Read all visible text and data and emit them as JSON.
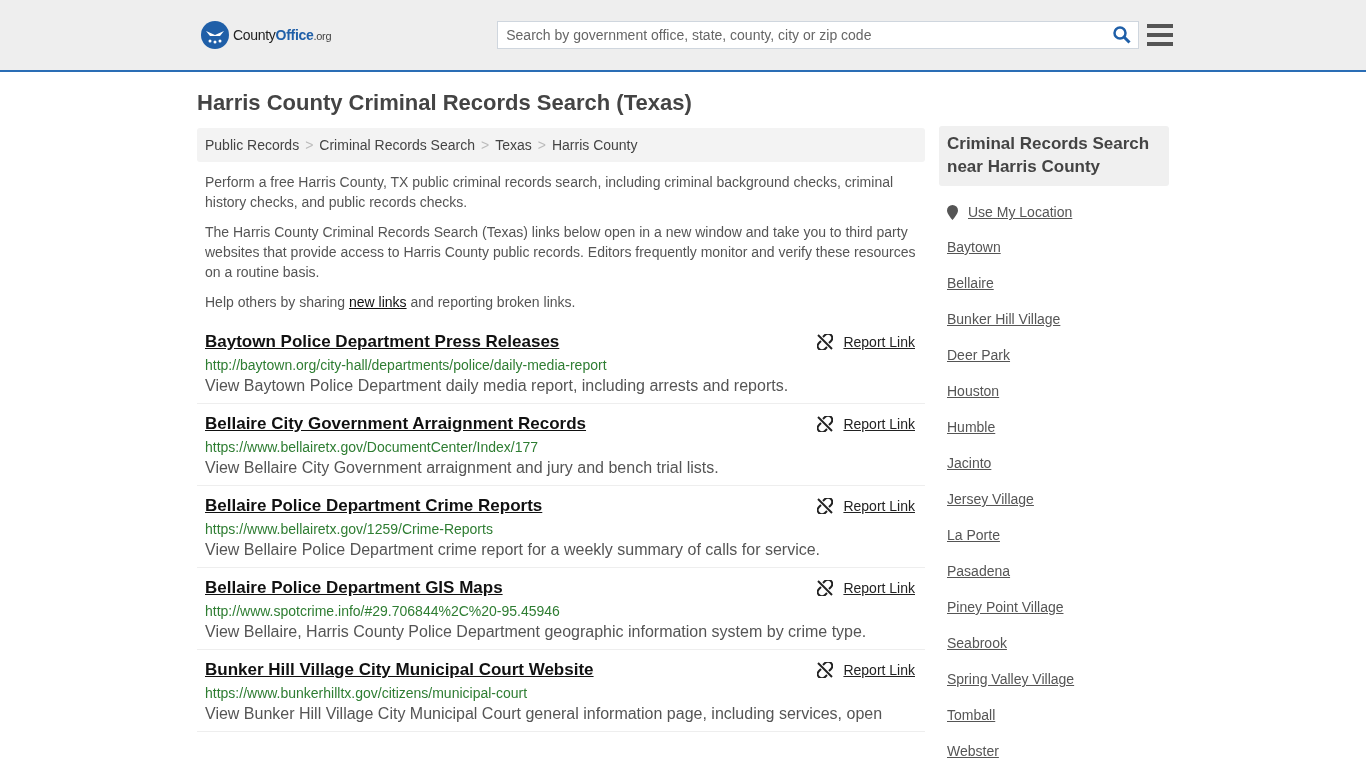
{
  "header": {
    "logo": {
      "name": "County",
      "brand": "Office",
      "tld": ".org"
    },
    "search": {
      "placeholder": "Search by government office, state, county, city or zip code"
    }
  },
  "title": "Harris County Criminal Records Search (Texas)",
  "breadcrumbs": [
    "Public Records",
    "Criminal Records Search",
    "Texas",
    "Harris County"
  ],
  "breadcrumb_separators": [
    ">",
    ">",
    ">"
  ],
  "intro": [
    "Perform a free Harris County, TX public criminal records search, including criminal background checks, criminal history checks, and public records checks.",
    "The Harris County Criminal Records Search (Texas) links below open in a new window and take you to third party websites that provide access to Harris County public records. Editors frequently monitor and verify these resources on a routine basis."
  ],
  "share": {
    "before": "Help others by sharing ",
    "link": "new links",
    "after": " and reporting broken links."
  },
  "results": [
    {
      "title": "Baytown Police Department Press Releases",
      "url": "http://baytown.org/city-hall/departments/police/daily-media-report",
      "description": "View Baytown Police Department daily media report, including arrests and reports.",
      "report": "Report Link"
    },
    {
      "title": "Bellaire City Government Arraignment Records",
      "url": "https://www.bellairetx.gov/DocumentCenter/Index/177",
      "description": "View Bellaire City Government arraignment and jury and bench trial lists.",
      "report": "Report Link"
    },
    {
      "title": "Bellaire Police Department Crime Reports",
      "url": "https://www.bellairetx.gov/1259/Crime-Reports",
      "description": "View Bellaire Police Department crime report for a weekly summary of calls for service.",
      "report": "Report Link"
    },
    {
      "title": "Bellaire Police Department GIS Maps",
      "url": "http://www.spotcrime.info/#29.706844%2C%20-95.45946",
      "description": "View Bellaire, Harris County Police Department geographic information system by crime type.",
      "report": "Report Link"
    },
    {
      "title": "Bunker Hill Village City Municipal Court Website",
      "url": "https://www.bunkerhilltx.gov/citizens/municipal-court",
      "description": "View Bunker Hill Village City Municipal Court general information page, including services, open",
      "report": "Report Link"
    }
  ],
  "sidebar": {
    "heading": "Criminal Records Search near Harris County",
    "location": "Use My Location",
    "places": [
      "Baytown",
      "Bellaire",
      "Bunker Hill Village",
      "Deer Park",
      "Houston",
      "Humble",
      "Jacinto",
      "Jersey Village",
      "La Porte",
      "Pasadena",
      "Piney Point Village",
      "Seabrook",
      "Spring Valley Village",
      "Tomball",
      "Webster"
    ]
  }
}
